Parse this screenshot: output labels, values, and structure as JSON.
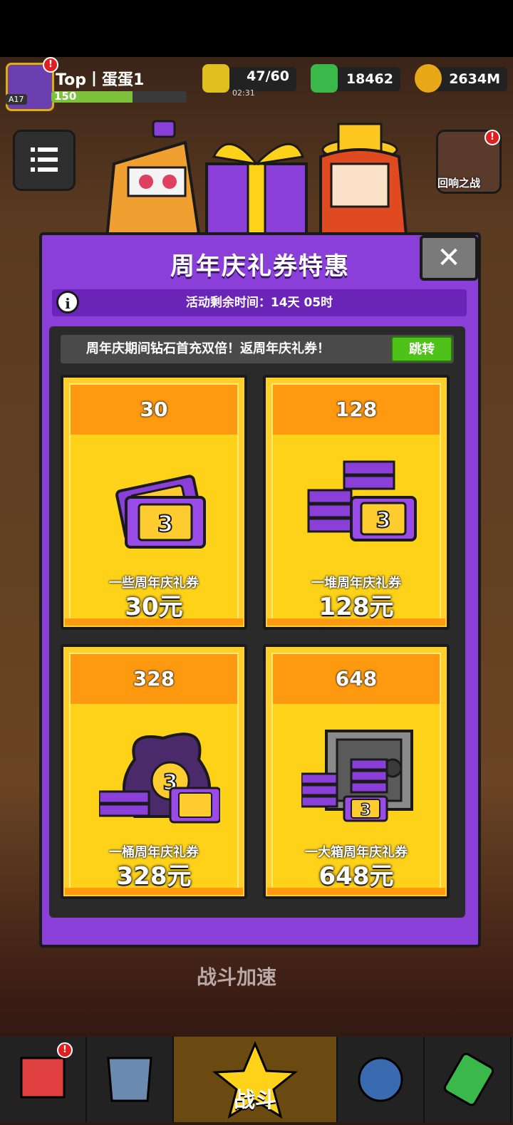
{
  "hud": {
    "player_name": "Top丨蛋蛋1",
    "level_badge": "A17",
    "xp_value": "150",
    "energy": "47/60",
    "energy_timer": "02:31",
    "gems": "18462",
    "gold": "2634M"
  },
  "side": {
    "right_top_label": "回响之战"
  },
  "modal": {
    "title": "周年庆礼券特惠",
    "close_glyph": "✕",
    "info_glyph": "i",
    "timer_text": "活动剩余时间：14天 05时",
    "promo_text": "周年庆期间钻石首充双倍！返周年庆礼券！",
    "jump_label": "跳转",
    "coupon_glyph": "3",
    "cards": [
      {
        "amount": "30",
        "name": "一些周年庆礼券",
        "price": "30元"
      },
      {
        "amount": "128",
        "name": "一堆周年庆礼券",
        "price": "128元"
      },
      {
        "amount": "328",
        "name": "一桶周年庆礼券",
        "price": "328元"
      },
      {
        "amount": "648",
        "name": "一大箱周年庆礼券",
        "price": "648元"
      }
    ]
  },
  "background": {
    "battle_speed": "战斗加速"
  },
  "nav": {
    "battle_label": "战斗"
  },
  "colors": {
    "modal_purple": "#8a3fd8",
    "card_yellow": "#ffd21a",
    "card_orange": "#ff9a10",
    "jump_green": "#4fc21a"
  }
}
